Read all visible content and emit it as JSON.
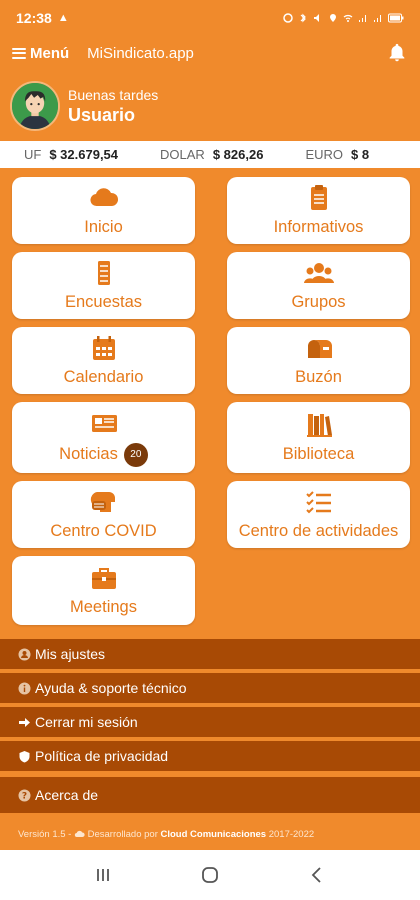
{
  "status_bar": {
    "time": "12:38"
  },
  "header": {
    "menu_label": "Menú",
    "app_name": "MiSindicato.app"
  },
  "profile": {
    "greeting": "Buenas tardes",
    "username": "Usuario"
  },
  "ticker": [
    {
      "label": "UF",
      "value": "$ 32.679,54"
    },
    {
      "label": "DOLAR",
      "value": "$ 826,26"
    },
    {
      "label": "EURO",
      "value": "$ 8"
    }
  ],
  "tiles": [
    {
      "label": "Inicio",
      "icon": "cloud-icon"
    },
    {
      "label": "Informativos",
      "icon": "clipboard-icon"
    },
    {
      "label": "Encuestas",
      "icon": "list-icon"
    },
    {
      "label": "Grupos",
      "icon": "group-icon"
    },
    {
      "label": "Calendario",
      "icon": "calendar-icon"
    },
    {
      "label": "Buzón",
      "icon": "mailbox-icon"
    },
    {
      "label": "Noticias",
      "icon": "newspaper-icon",
      "badge": "20"
    },
    {
      "label": "Biblioteca",
      "icon": "books-icon"
    },
    {
      "label": "Centro COVID",
      "icon": "covid-icon"
    },
    {
      "label": "Centro de actividades",
      "icon": "checklist-icon"
    },
    {
      "label": "Meetings",
      "icon": "briefcase-icon"
    }
  ],
  "menu": [
    {
      "label": "Mis ajustes",
      "icon": "user-settings-icon"
    },
    {
      "label": "Ayuda & soporte técnico",
      "icon": "info-icon"
    },
    {
      "label": "Cerrar mi sesión",
      "icon": "logout-icon"
    },
    {
      "label": "Política de privacidad",
      "icon": "shield-icon"
    },
    {
      "label": "Acerca de",
      "icon": "help-icon"
    }
  ],
  "footer": {
    "version": "Versión 1.5 -",
    "developed_by": "Desarrollado por",
    "company": "Cloud Comunicaciones",
    "years": "2017-2022"
  },
  "colors": {
    "primary": "#f08a2c",
    "dark_menu": "#a84a05",
    "tile_text": "#e57a1c"
  }
}
